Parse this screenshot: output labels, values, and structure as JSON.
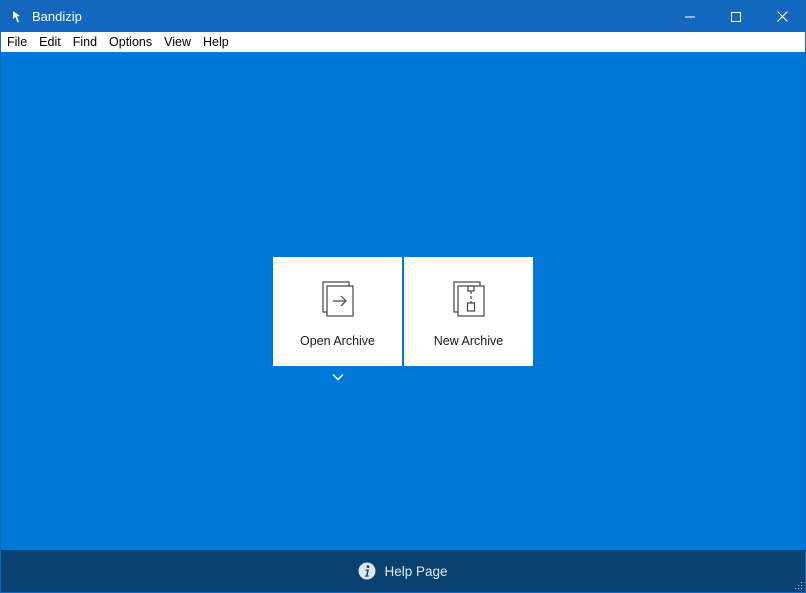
{
  "window": {
    "title": "Bandizip",
    "controls": {
      "minimize": "minimize",
      "maximize": "maximize",
      "close": "close"
    }
  },
  "menu": {
    "items": [
      {
        "label": "File"
      },
      {
        "label": "Edit"
      },
      {
        "label": "Find"
      },
      {
        "label": "Options"
      },
      {
        "label": "View"
      },
      {
        "label": "Help"
      }
    ]
  },
  "actions": {
    "open_archive": {
      "label": "Open Archive",
      "icon": "open-archive-icon"
    },
    "new_archive": {
      "label": "New Archive",
      "icon": "new-archive-icon"
    }
  },
  "footer": {
    "help_label": "Help Page",
    "icon": "info-icon"
  },
  "colors": {
    "accent": "#0078d7",
    "titlebar": "#1467bf",
    "footer": "#08406f",
    "tile": "#ffffff"
  }
}
